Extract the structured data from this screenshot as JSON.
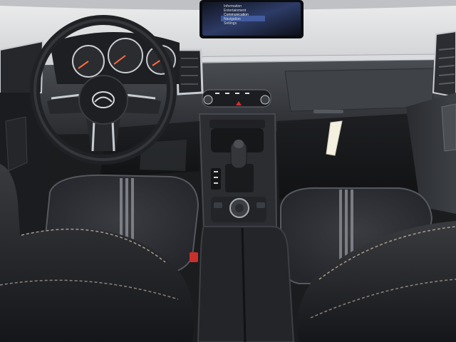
{
  "image": {
    "subject": "car-interior-front-cabin",
    "brand_emblem": "Mazda",
    "colors": {
      "dash_top": "#e3e4e6",
      "dash_mid": "#3a3d42",
      "seat_fabric": "#2b2d33",
      "seat_leather": "#1d1e21",
      "chrome": "#c9ccd1",
      "screen_glow": "#2d3b66"
    }
  },
  "infotainment": {
    "menu_items": [
      "Information",
      "Entertainment",
      "Communication",
      "Navigation",
      "Settings"
    ],
    "selected_index": 2
  },
  "instrument_cluster": {
    "gauges": [
      "tachometer-gauge",
      "speedometer-gauge",
      "fuel-temp-gauge"
    ]
  },
  "icons": [
    "mazda-emblem-icon",
    "hazard-icon",
    "gear-shifter-icon",
    "commander-knob-icon"
  ]
}
